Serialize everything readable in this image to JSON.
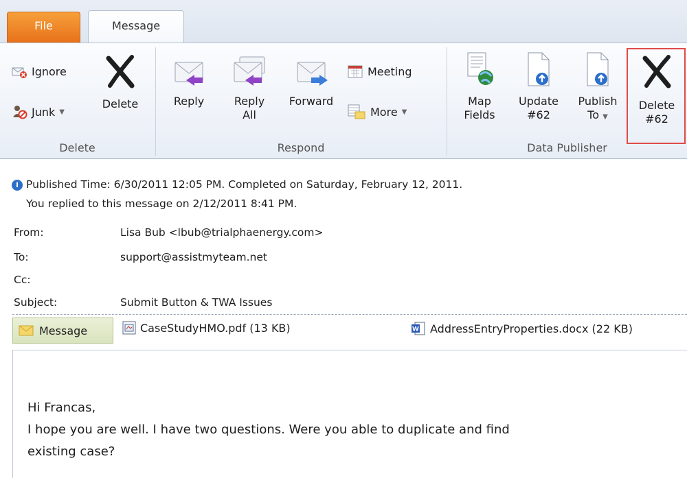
{
  "tabs": {
    "file": "File",
    "message": "Message"
  },
  "ribbon": {
    "delete_group": {
      "ignore": "Ignore",
      "junk": "Junk",
      "delete": "Delete",
      "label": "Delete"
    },
    "respond_group": {
      "reply": "Reply",
      "reply_all_1": "Reply",
      "reply_all_2": "All",
      "forward": "Forward",
      "meeting": "Meeting",
      "more": "More",
      "label": "Respond"
    },
    "data_publisher_group": {
      "map_fields_1": "Map",
      "map_fields_2": "Fields",
      "update_1": "Update",
      "update_2": "#62",
      "publish_1": "Publish",
      "publish_2": "To",
      "delete_1": "Delete",
      "delete_2": "#62",
      "label": "Data Publisher"
    }
  },
  "info": {
    "line1": "Published Time: 6/30/2011 12:05 PM.  Completed on Saturday, February 12, 2011.",
    "line2": "You replied to this message on 2/12/2011 8:41 PM."
  },
  "header": {
    "from_label": "From:",
    "from_value": "Lisa Bub <lbub@trialphaenergy.com>",
    "to_label": "To:",
    "to_value": "support@assistmyteam.net",
    "cc_label": "Cc:",
    "cc_value": "",
    "subject_label": "Subject:",
    "subject_value": "Submit Button & TWA Issues"
  },
  "attachments": {
    "message_tab": "Message",
    "items": [
      {
        "name": "CaseStudyHMO.pdf (13 KB)"
      },
      {
        "name": "AddressEntryProperties.docx (22 KB)"
      }
    ]
  },
  "body": {
    "greeting": "Hi Francas,",
    "line1": "I hope you are well.  I have two questions.  Were you able to duplicate and find",
    "line2": "existing case?"
  },
  "colors": {
    "file_tab": "#e8711a",
    "highlight": "#e04a4a",
    "accent_blue": "#2c6fc9"
  }
}
